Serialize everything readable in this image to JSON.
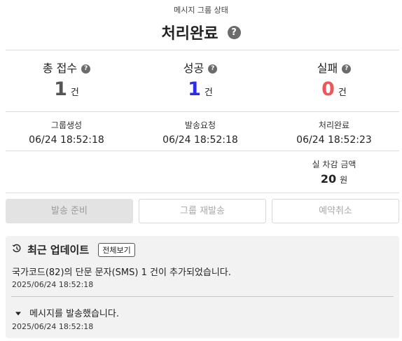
{
  "header": {
    "subtitle": "메시지 그룹 상태",
    "title": "처리완료",
    "help_icon": "question-circle-icon"
  },
  "stats": [
    {
      "label": "총 접수",
      "value": "1",
      "unit": "건",
      "color": "#555555"
    },
    {
      "label": "성공",
      "value": "1",
      "unit": "건",
      "color": "#2c2cf0"
    },
    {
      "label": "실패",
      "value": "0",
      "unit": "건",
      "color": "#f25555"
    }
  ],
  "times": [
    {
      "label": "그룹생성",
      "value": "06/24 18:52:18"
    },
    {
      "label": "발송요청",
      "value": "06/24 18:52:18"
    },
    {
      "label": "처리완료",
      "value": "06/24 18:52:23"
    }
  ],
  "cost": {
    "label": "실 차감 금액",
    "value": "20",
    "unit": "원"
  },
  "buttons": {
    "send_ready": "발송 준비",
    "group_resend": "그룹 재발송",
    "cancel_reservation": "예약취소"
  },
  "updates": {
    "icon": "history-icon",
    "title": "최근 업데이트",
    "view_all": "전체보기",
    "items": [
      {
        "text": "국가코드(82)의 단문 문자(SMS) 1 건이 추가되었습니다.",
        "time": "2025/06/24 18:52:18"
      },
      {
        "text": "메시지를 발송했습니다.",
        "time": "2025/06/24 18:52:18",
        "icon": "caret-down-icon"
      }
    ]
  }
}
